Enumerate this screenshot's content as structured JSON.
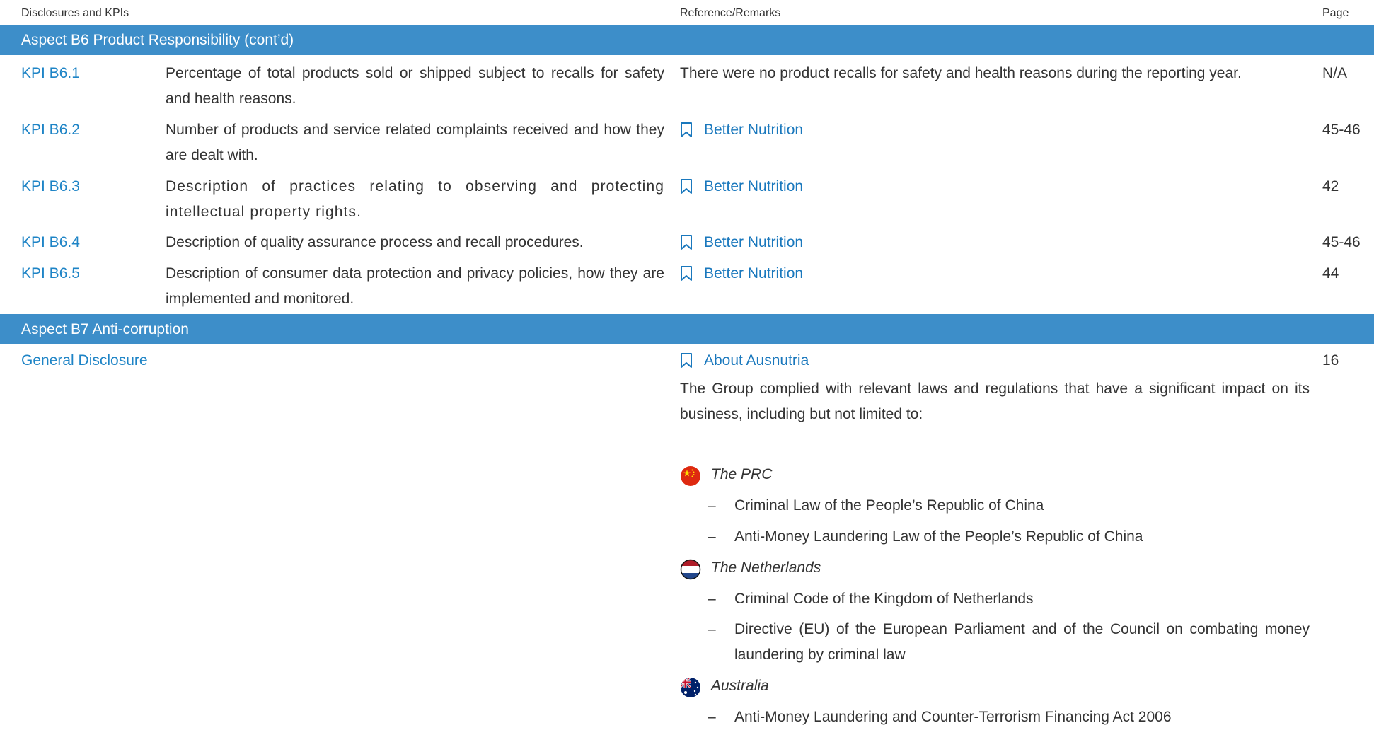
{
  "header": {
    "col1": "Disclosures and KPIs",
    "col2": "Reference/Remarks",
    "col3": "Page"
  },
  "aspect_b6": {
    "title": "Aspect B6 Product Responsibility (cont’d)",
    "rows": [
      {
        "id": "KPI B6.1",
        "description": "Percentage of total products sold or shipped subject to recalls for safety and health reasons.",
        "remark": "There were no product recalls for safety and health reasons during the reporting year.",
        "page": "N/A"
      },
      {
        "id": "KPI B6.2",
        "description": "Number of products and service related complaints received and how they are dealt with.",
        "link": "Better Nutrition",
        "page": "45-46"
      },
      {
        "id": "KPI B6.3",
        "description": "Description of practices relating to observing and protecting intellectual property rights.",
        "link": "Better Nutrition",
        "page": "42"
      },
      {
        "id": "KPI B6.4",
        "description": "Description of quality assurance process and recall procedures.",
        "link": "Better Nutrition",
        "page": "45-46"
      },
      {
        "id": "KPI B6.5",
        "description": "Description of consumer data protection and privacy policies, how they are implemented and monitored.",
        "link": "Better Nutrition",
        "page": "44"
      }
    ]
  },
  "aspect_b7": {
    "title": "Aspect B7 Anti-corruption",
    "general": {
      "label": "General Disclosure",
      "link": "About Ausnutria",
      "page": "16",
      "intro": "The Group complied with relevant laws and regulations that have a significant impact on its business, including but not limited to:",
      "dash": "–",
      "countries": [
        {
          "name": "The PRC",
          "flag_icon": "china-flag-icon",
          "laws": [
            "Criminal Law of the People’s Republic of China",
            "Anti-Money Laundering Law of the People’s Republic of China"
          ]
        },
        {
          "name": "The Netherlands",
          "flag_icon": "netherlands-flag-icon",
          "laws": [
            "Criminal Code of the Kingdom of Netherlands",
            "Directive (EU) of the European Parliament and of the Council on combating money laundering by criminal law"
          ]
        },
        {
          "name": "Australia",
          "flag_icon": "australia-flag-icon",
          "laws": [
            "Anti-Money Laundering and Counter-Terrorism Financing Act 2006"
          ]
        }
      ]
    }
  },
  "colors": {
    "band": "#3d8ec9",
    "link": "#1a78bd",
    "kpi_id": "#1e84c6",
    "text": "#333333"
  }
}
